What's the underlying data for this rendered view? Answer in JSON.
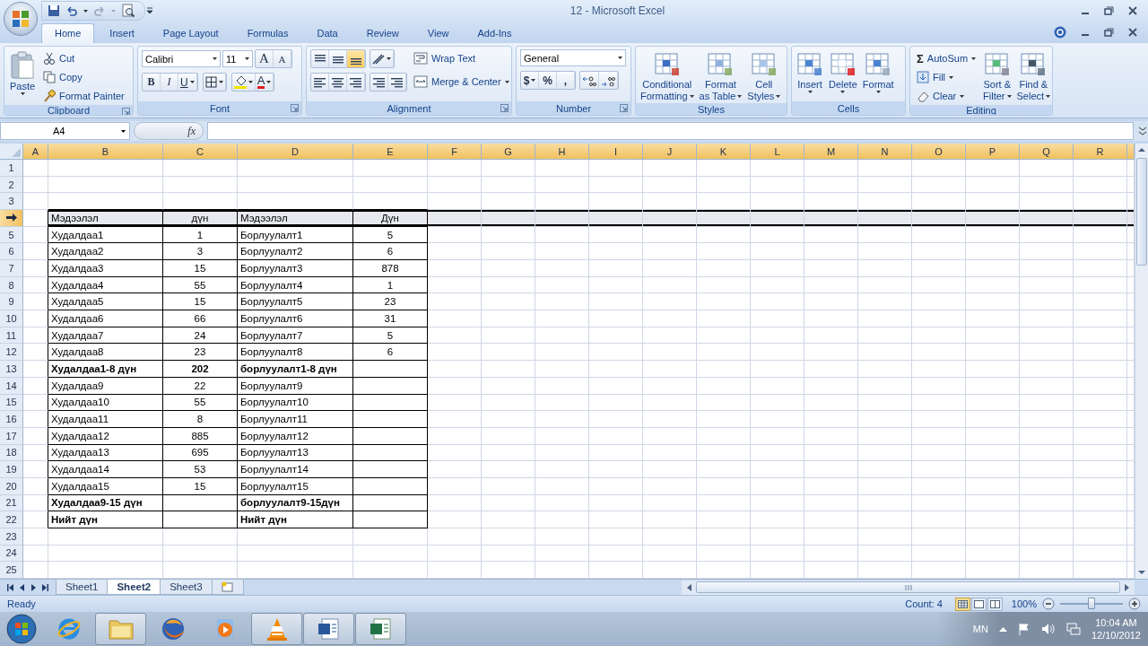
{
  "window": {
    "title": "12 - Microsoft Excel"
  },
  "tabs": [
    {
      "label": "Home",
      "selected": true
    },
    {
      "label": "Insert",
      "selected": false
    },
    {
      "label": "Page Layout",
      "selected": false
    },
    {
      "label": "Formulas",
      "selected": false
    },
    {
      "label": "Data",
      "selected": false
    },
    {
      "label": "Review",
      "selected": false
    },
    {
      "label": "View",
      "selected": false
    },
    {
      "label": "Add-Ins",
      "selected": false
    }
  ],
  "ribbon": {
    "groups": [
      {
        "kind": "clipboard",
        "label": "Clipboard",
        "dialog_launcher": true,
        "paste": "Paste",
        "items": [
          "Cut",
          "Copy",
          "Format Painter"
        ]
      },
      {
        "kind": "font",
        "label": "Font",
        "dialog_launcher": true,
        "font_name": "Calibri",
        "font_size": "11",
        "grow": "A",
        "shrink": "A",
        "bold": "B",
        "italic": "I",
        "underline": "U",
        "font_color": "A"
      },
      {
        "kind": "alignment",
        "label": "Alignment",
        "dialog_launcher": true,
        "vertical_align": [
          {
            "selected": false
          },
          {
            "selected": false
          },
          {
            "selected": true
          }
        ],
        "wrap": "Wrap Text",
        "merge": "Merge & Center"
      },
      {
        "kind": "number",
        "label": "Number",
        "dialog_launcher": true,
        "format": "General",
        "currency": "$",
        "percent": "%",
        "comma": ","
      },
      {
        "kind": "styles",
        "label": "Styles",
        "dialog_launcher": false,
        "buttons": [
          {
            "lines": [
              "Conditional",
              "Formatting"
            ]
          },
          {
            "lines": [
              "Format",
              "as Table"
            ]
          },
          {
            "lines": [
              "Cell",
              "Styles"
            ]
          }
        ]
      },
      {
        "kind": "cells",
        "label": "Cells",
        "dialog_launcher": false,
        "buttons": [
          {
            "lines": [
              "Insert"
            ]
          },
          {
            "lines": [
              "Delete"
            ]
          },
          {
            "lines": [
              "Format"
            ]
          }
        ]
      },
      {
        "kind": "editing",
        "label": "Editing",
        "dialog_launcher": false,
        "autosum_symbol": "Σ",
        "items": [
          "AutoSum",
          "Fill",
          "Clear"
        ],
        "buttons": [
          {
            "lines": [
              "Sort &",
              "Filter"
            ]
          },
          {
            "lines": [
              "Find &",
              "Select"
            ]
          }
        ]
      }
    ]
  },
  "formula_bar": {
    "name_box": "A4",
    "function_label": "fx"
  },
  "sheet": {
    "columns": [
      "A",
      "B",
      "C",
      "D",
      "E",
      "F",
      "G",
      "H",
      "I",
      "J",
      "K",
      "L",
      "M",
      "N",
      "O",
      "P",
      "Q",
      "R"
    ],
    "rows": [
      {
        "number": "1",
        "selected": false
      },
      {
        "number": "2",
        "selected": false
      },
      {
        "number": "3",
        "selected": false
      },
      {
        "selected": true,
        "bold": false,
        "b": "Мэдээлэл",
        "c": "дүн",
        "d": "Мэдээлэл",
        "e": "Дүн"
      },
      {
        "number": "5",
        "selected": false,
        "bold": false,
        "b": "Худалдаа1",
        "c": "1",
        "d": "Борлуулалт1",
        "e": "5"
      },
      {
        "number": "6",
        "selected": false,
        "bold": false,
        "b": "Худалдаа2",
        "c": "3",
        "d": "Борлуулалт2",
        "e": "6"
      },
      {
        "number": "7",
        "selected": false,
        "bold": false,
        "b": "Худалдаа3",
        "c": "15",
        "d": "Борлуулалт3",
        "e": "878"
      },
      {
        "number": "8",
        "selected": false,
        "bold": false,
        "b": "Худалдаа4",
        "c": "55",
        "d": "Борлуулалт4",
        "e": "1"
      },
      {
        "number": "9",
        "selected": false,
        "bold": false,
        "b": "Худалдаа5",
        "c": "15",
        "d": "Борлуулалт5",
        "e": "23"
      },
      {
        "number": "10",
        "selected": false,
        "bold": false,
        "b": "Худалдаа6",
        "c": "66",
        "d": "Борлуулалт6",
        "e": "31"
      },
      {
        "number": "11",
        "selected": false,
        "bold": false,
        "b": "Худалдаа7",
        "c": "24",
        "d": "Борлуулалт7",
        "e": "5"
      },
      {
        "number": "12",
        "selected": false,
        "bold": false,
        "b": "Худалдаа8",
        "c": "23",
        "d": "Борлуулалт8",
        "e": "6"
      },
      {
        "number": "13",
        "selected": false,
        "bold": true,
        "b": "Худалдаа1-8 дүн",
        "c": "202",
        "d": "борлуулалт1-8 дүн"
      },
      {
        "number": "14",
        "selected": false,
        "bold": false,
        "b": "Худалдаа9",
        "c": "22",
        "d": "Борлуулалт9"
      },
      {
        "number": "15",
        "selected": false,
        "bold": false,
        "b": "Худалдаа10",
        "c": "55",
        "d": "Борлуулалт10"
      },
      {
        "number": "16",
        "selected": false,
        "bold": false,
        "b": "Худалдаа11",
        "c": "8",
        "d": "Борлуулалт11"
      },
      {
        "number": "17",
        "selected": false,
        "bold": false,
        "b": "Худалдаа12",
        "c": "885",
        "d": "Борлуулалт12"
      },
      {
        "number": "18",
        "selected": false,
        "bold": false,
        "b": "Худалдаа13",
        "c": "695",
        "d": "Борлуулалт13"
      },
      {
        "number": "19",
        "selected": false,
        "bold": false,
        "b": "Худалдаа14",
        "c": "53",
        "d": "Борлуулалт14"
      },
      {
        "number": "20",
        "selected": false,
        "bold": false,
        "b": "Худалдаа15",
        "c": "15",
        "d": "Борлуулалт15"
      },
      {
        "number": "21",
        "selected": false,
        "bold": true,
        "b": "Худалдаа9-15 дүн",
        "d": "борлуулалт9-15дүн"
      },
      {
        "number": "22",
        "selected": false,
        "bold": true,
        "b": "Нийт дүн",
        "d": "Нийт дүн"
      },
      {
        "number": "23",
        "selected": false
      },
      {
        "number": "24",
        "selected": false
      },
      {
        "number": "25",
        "selected": false
      }
    ]
  },
  "sheet_tabs": [
    {
      "label": "Sheet1",
      "selected": false
    },
    {
      "label": "Sheet2",
      "selected": true
    },
    {
      "label": "Sheet3",
      "selected": false
    }
  ],
  "status_bar": {
    "text": "Ready",
    "count": "Count: 4",
    "views": [
      {
        "selected": true
      },
      {
        "selected": false
      },
      {
        "selected": false
      }
    ],
    "zoom": "100%",
    "zoom_slider": {
      "level": 0.5
    }
  },
  "taskbar": {
    "apps": [
      {
        "kind": "ie",
        "running": false
      },
      {
        "kind": "folder",
        "running": true
      },
      {
        "kind": "firefox",
        "running": false
      },
      {
        "kind": "media",
        "running": false
      },
      {
        "kind": "vlc",
        "running": true
      },
      {
        "kind": "word",
        "running": true
      },
      {
        "kind": "excel",
        "running": true
      }
    ],
    "language": "MN",
    "time": "10:04 AM",
    "date": "12/10/2012"
  }
}
